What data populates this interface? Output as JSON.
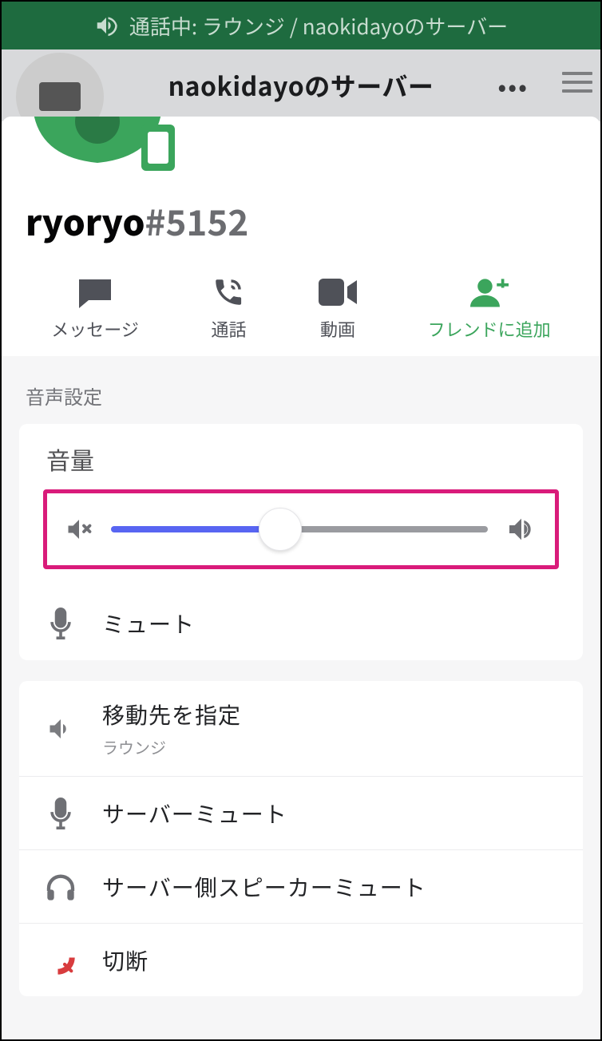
{
  "status_banner": {
    "text": "通話中: ラウンジ / naokidayoのサーバー"
  },
  "header": {
    "title": "naokidayoのサーバー"
  },
  "profile": {
    "username": "ryoryo",
    "discriminator": "#5152"
  },
  "actions": {
    "message": "メッセージ",
    "call": "通話",
    "video": "動画",
    "add_friend": "フレンドに追加"
  },
  "audio_settings": {
    "section_title": "音声設定",
    "volume_label": "音量",
    "volume_percent": 45,
    "mute_label": "ミュート"
  },
  "server_options": {
    "move_to_label": "移動先を指定",
    "move_to_sub": "ラウンジ",
    "server_mute": "サーバーミュート",
    "server_deafen": "サーバー側スピーカーミュート",
    "disconnect": "切断"
  },
  "colors": {
    "banner_bg": "#1e6b3f",
    "accent_green": "#3ba55c",
    "blurple": "#5865f2",
    "highlight": "#d91b7a",
    "disconnect_red": "#d83c3e"
  }
}
